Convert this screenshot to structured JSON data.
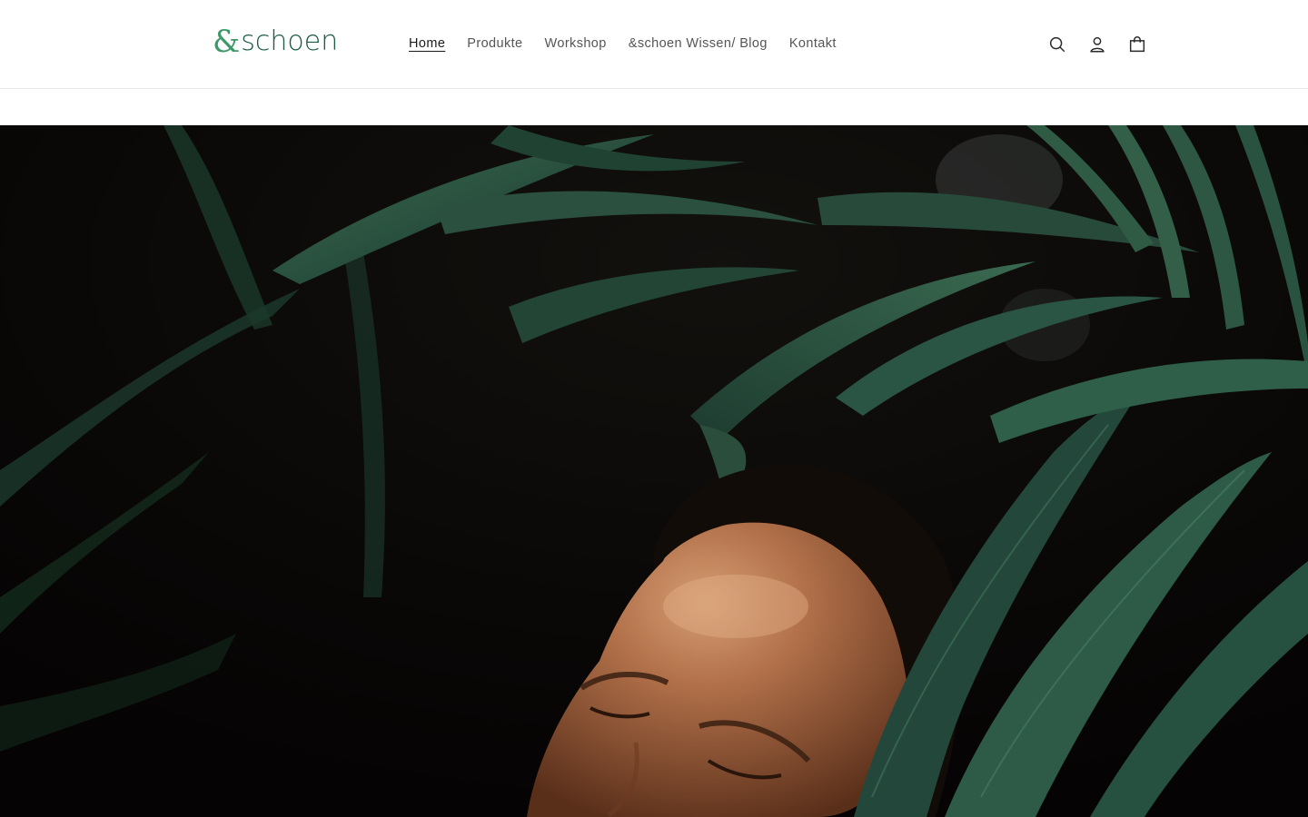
{
  "brand": {
    "logo_amp": "&",
    "logo_word": "schoen",
    "logo_color_primary": "#3d9a68",
    "logo_color_secondary": "#1c5a45"
  },
  "nav": {
    "items": [
      {
        "label": "Home",
        "active": true
      },
      {
        "label": "Produkte",
        "active": false
      },
      {
        "label": "Workshop",
        "active": false
      },
      {
        "label": "&schoen Wissen/ Blog",
        "active": false
      },
      {
        "label": "Kontakt",
        "active": false
      }
    ]
  },
  "header_icons": [
    "search-icon",
    "account-icon",
    "cart-icon"
  ],
  "hero": {
    "image": "dark-foliage-woman-smiling",
    "palette": {
      "background": "#070404",
      "leaf_dark": "#17352a",
      "leaf_mid": "#244a3a",
      "leaf_light": "#3b6b52",
      "skin": "#a0623e",
      "skin_highlight": "#d69e74",
      "hair": "#120c08"
    }
  }
}
